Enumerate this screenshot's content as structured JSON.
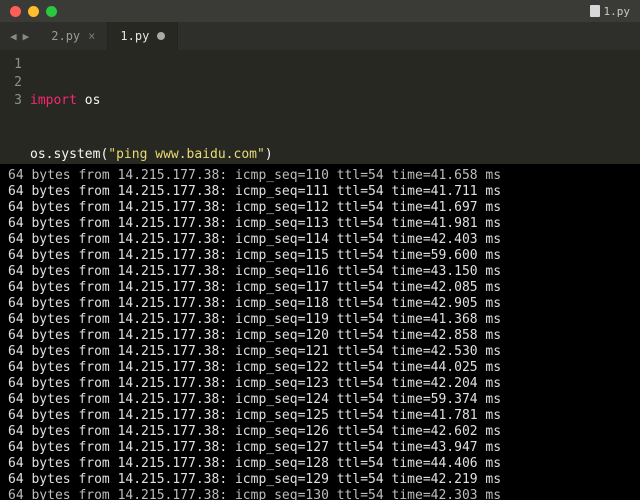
{
  "window": {
    "title": "1.py"
  },
  "tabs": {
    "inactive1": {
      "label": "2.py"
    },
    "active": {
      "label": "1.py"
    }
  },
  "code": {
    "l1_kw": "import",
    "l1_mod": "os",
    "l2_obj": "os",
    "l2_dot": ".",
    "l2_fn": "system",
    "l2_open": "(",
    "l2_str": "\"ping www.baidu.com\"",
    "l2_close": ")"
  },
  "lineNumbers": {
    "n1": "1",
    "n2": "2",
    "n3": "3"
  },
  "console": {
    "ip": "14.215.177.38",
    "cutoff_line": "64 bytes from 14.215.177.38: icmp_seq=110 ttl=54 time=41.658 ms",
    "rows": [
      {
        "seq": "111",
        "ttl": "54",
        "time": "41.711"
      },
      {
        "seq": "112",
        "ttl": "54",
        "time": "41.697"
      },
      {
        "seq": "113",
        "ttl": "54",
        "time": "41.981"
      },
      {
        "seq": "114",
        "ttl": "54",
        "time": "42.403"
      },
      {
        "seq": "115",
        "ttl": "54",
        "time": "59.600"
      },
      {
        "seq": "116",
        "ttl": "54",
        "time": "43.150"
      },
      {
        "seq": "117",
        "ttl": "54",
        "time": "42.085"
      },
      {
        "seq": "118",
        "ttl": "54",
        "time": "42.905"
      },
      {
        "seq": "119",
        "ttl": "54",
        "time": "41.368"
      },
      {
        "seq": "120",
        "ttl": "54",
        "time": "42.858"
      },
      {
        "seq": "121",
        "ttl": "54",
        "time": "42.530"
      },
      {
        "seq": "122",
        "ttl": "54",
        "time": "44.025"
      },
      {
        "seq": "123",
        "ttl": "54",
        "time": "42.204"
      },
      {
        "seq": "124",
        "ttl": "54",
        "time": "59.374"
      },
      {
        "seq": "125",
        "ttl": "54",
        "time": "41.781"
      },
      {
        "seq": "126",
        "ttl": "54",
        "time": "42.602"
      },
      {
        "seq": "127",
        "ttl": "54",
        "time": "43.947"
      },
      {
        "seq": "128",
        "ttl": "54",
        "time": "44.406"
      },
      {
        "seq": "129",
        "ttl": "54",
        "time": "42.219"
      }
    ],
    "bottom_cut": "64 bytes from 14.215.177.38: icmp_seq=130 ttl=54 time=42.303 ms"
  }
}
